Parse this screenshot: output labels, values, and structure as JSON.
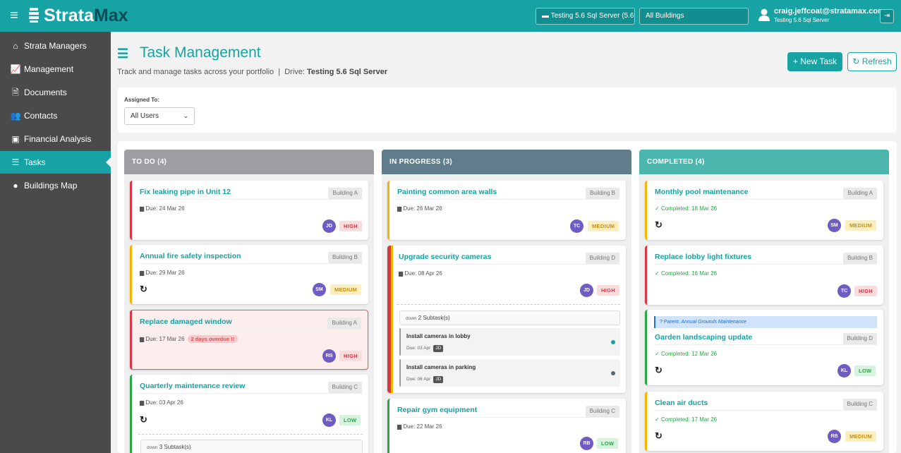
{
  "app": {
    "name_strata": "Strata",
    "name_max": "Max",
    "menu_icon": "hamburger-icon"
  },
  "topbar": {
    "server": "Testing 5.6 Sql Server (5.6.",
    "building_filter": "All Buildings",
    "user_email": "craig.jeffcoat@stratamax.com",
    "user_server": "Testing 5.6 Sql Server"
  },
  "sidebar": {
    "items": [
      {
        "label": "Strata Managers",
        "icon": "home-icon"
      },
      {
        "label": "Management",
        "icon": "chart-line-icon"
      },
      {
        "label": "Documents",
        "icon": "document-icon"
      },
      {
        "label": "Contacts",
        "icon": "users-icon"
      },
      {
        "label": "Financial Analysis",
        "icon": "money-icon"
      },
      {
        "label": "Tasks",
        "icon": "tasks-icon",
        "active": true
      },
      {
        "label": "Buildings Map",
        "icon": "map-pin-icon"
      }
    ]
  },
  "page": {
    "title": "Task Management",
    "subtitle": "Track and manage tasks across your portfolio",
    "drive_label": "Drive:",
    "drive_value": "Testing 5.6 Sql Server",
    "new_task": "+ New Task",
    "refresh": "Refresh"
  },
  "filter": {
    "label": "Assigned To:",
    "value": "All Users"
  },
  "colors": {
    "accent": "#17a2a3",
    "todo": "#9e9ea2",
    "in_progress": "#607d8b",
    "completed": "#4db6ac"
  },
  "columns": {
    "todo": {
      "title": "TO DO (4)",
      "cards": [
        {
          "title": "Fix leaking pipe in Unit 12",
          "building": "Building A",
          "due": "Due: 24 Mar 26",
          "avatar": "JD",
          "priority": "HIGH"
        },
        {
          "title": "Annual fire safety inspection",
          "building": "Building B",
          "due": "Due: 29 Mar 26",
          "avatar": "SM",
          "priority": "MEDIUM"
        },
        {
          "title": "Replace damaged window",
          "building": "Building A",
          "due": "Due: 17 Mar 26",
          "overdue": "2 days overdue !!",
          "avatar": "RB",
          "priority": "HIGH"
        },
        {
          "title": "Quarterly maintenance review",
          "building": "Building C",
          "due": "Due: 03 Apr 26",
          "avatar": "KL",
          "priority": "LOW",
          "subtasks": "3 Subtask(s)",
          "subtask_toggle": "down"
        }
      ]
    },
    "in_progress": {
      "title": "IN PROGRESS (3)",
      "cards": [
        {
          "title": "Painting common area walls",
          "building": "Building B",
          "due": "Due: 26 Mar 26",
          "avatar": "TC",
          "priority": "MEDIUM"
        },
        {
          "title": "Upgrade security cameras",
          "building": "Building D",
          "due": "Due: 08 Apr 26",
          "avatar": "JD",
          "priority": "HIGH",
          "subtasks": "2 Subtask(s)",
          "subtask_toggle": "down",
          "subtask_list": [
            {
              "title": "Install cameras in lobby",
              "due": "Due: 03 Apr",
              "avatar": "JD"
            },
            {
              "title": "Install cameras in parking",
              "due": "Due: 06 Apr",
              "avatar": "JD"
            }
          ]
        },
        {
          "title": "Repair gym equipment",
          "building": "Building C",
          "due": "Due: 22 Mar 26",
          "avatar": "RB",
          "priority": "LOW"
        }
      ]
    },
    "completed": {
      "title": "COMPLETED (4)",
      "cards": [
        {
          "title": "Monthly pool maintenance",
          "building": "Building A",
          "done": "Completed: 18 Mar 26",
          "avatar": "SM",
          "priority": "MEDIUM"
        },
        {
          "title": "Replace lobby light fixtures",
          "building": "Building B",
          "done": "Completed: 16 Mar 26",
          "avatar": "TC",
          "priority": "HIGH"
        },
        {
          "title": "Garden landscaping update",
          "building": "Building D",
          "done": "Completed: 12 Mar 26",
          "avatar": "KL",
          "priority": "LOW",
          "parent_label": "? Parent:",
          "parent": "Annual Grounds Maintenance"
        },
        {
          "title": "Clean air ducts",
          "building": "Building C",
          "done": "Completed: 17 Mar 26",
          "avatar": "RB",
          "priority": "MEDIUM"
        }
      ]
    }
  }
}
